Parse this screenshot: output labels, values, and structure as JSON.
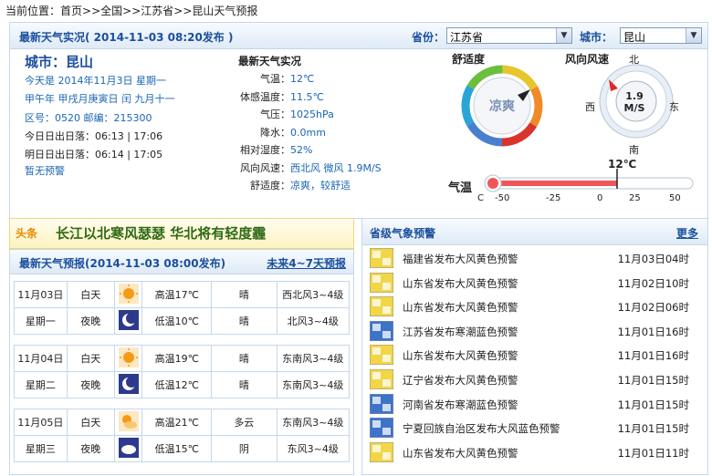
{
  "breadcrumb": {
    "prefix": "当前位置：",
    "items": [
      "首页",
      "全国",
      "江苏省",
      "昆山天气预报"
    ],
    "sep": ">>"
  },
  "top": {
    "title": "最新天气实况",
    "publish": "( 2014-11-03  08:20发布 )",
    "province_label": "省份：",
    "province_value": "江苏省",
    "city_label": "城市：",
    "city_value": "昆山"
  },
  "city": {
    "name": "城市：昆山",
    "date": "今天是 2014年11月3日 星期一",
    "lunar": "甲午年 甲戌月庚寅日 闰 九月十一",
    "codes": "区号：0520   邮编：215300",
    "sun_today": "今日日出日落：06:13 | 17:06",
    "sun_tomorrow": "明日日出日落：06:14 | 17:05",
    "alert": "暂无预警"
  },
  "live": {
    "heading": "最新天气实况",
    "rows": [
      {
        "label": "气温：",
        "value": "12℃"
      },
      {
        "label": "体感温度：",
        "value": "11.5℃"
      },
      {
        "label": "气压：",
        "value": "1025hPa"
      },
      {
        "label": "降水：",
        "value": "0.0mm"
      },
      {
        "label": "相对湿度：",
        "value": "52%"
      },
      {
        "label": "风向风速：",
        "value": "西北风 微风 1.9M/S"
      },
      {
        "label": "舒适度：",
        "value": "凉爽，较舒适"
      }
    ]
  },
  "comfort": {
    "label": "舒适度",
    "value": "凉爽"
  },
  "wind": {
    "label": "风向风速",
    "speed": "1.9",
    "unit": "M/S",
    "n": "北",
    "s": "南",
    "e": "东",
    "w": "西"
  },
  "thermo": {
    "label": "气温",
    "value_text": "12℃",
    "unit": "C",
    "ticks": [
      "-50",
      "-25",
      "0",
      "25",
      "50"
    ],
    "value": 12
  },
  "headline": {
    "tag": "头条",
    "text": "长江以北寒风瑟瑟  华北将有轻度霾"
  },
  "forecast": {
    "title": "最新天气预报",
    "publish": "(2014-11-03  08:00发布)",
    "link": "未来4~7天预报",
    "days": [
      {
        "date": "11月03日",
        "week": "星期一",
        "day": {
          "period": "白天",
          "icon": "sunny-icon",
          "temp": "高温17℃",
          "weather": "晴",
          "wind": "西北风3~4级"
        },
        "night": {
          "period": "夜晚",
          "icon": "moon-icon",
          "temp": "低温10℃",
          "weather": "晴",
          "wind": "北风3~4级"
        }
      },
      {
        "date": "11月04日",
        "week": "星期二",
        "day": {
          "period": "白天",
          "icon": "sunny-icon",
          "temp": "高温19℃",
          "weather": "晴",
          "wind": "东南风3~4级"
        },
        "night": {
          "period": "夜晚",
          "icon": "moon-icon",
          "temp": "低温12℃",
          "weather": "晴",
          "wind": "东南风3~4级"
        }
      },
      {
        "date": "11月05日",
        "week": "星期三",
        "day": {
          "period": "白天",
          "icon": "partly-cloudy-icon",
          "temp": "高温21℃",
          "weather": "多云",
          "wind": "东南风3~4级"
        },
        "night": {
          "period": "夜晚",
          "icon": "cloud-night-icon",
          "temp": "低温15℃",
          "weather": "阴",
          "wind": "东风3~4级"
        }
      }
    ]
  },
  "warnings": {
    "title": "省级气象预警",
    "more": "更多",
    "items": [
      {
        "text": "福建省发布大风黄色预警",
        "date": "11月03日04时",
        "color": "#f1d648"
      },
      {
        "text": "山东省发布大风黄色预警",
        "date": "11月02日10时",
        "color": "#f1d648"
      },
      {
        "text": "山东省发布大风黄色预警",
        "date": "11月02日06时",
        "color": "#f1d648"
      },
      {
        "text": "江苏省发布寒潮蓝色预警",
        "date": "11月01日16时",
        "color": "#3d73c9"
      },
      {
        "text": "山东省发布大风黄色预警",
        "date": "11月01日16时",
        "color": "#f1d648"
      },
      {
        "text": "辽宁省发布大风黄色预警",
        "date": "11月01日15时",
        "color": "#f1d648"
      },
      {
        "text": "河南省发布寒潮蓝色预警",
        "date": "11月01日15时",
        "color": "#3d73c9"
      },
      {
        "text": "宁夏回族自治区发布大风蓝色预警",
        "date": "11月01日15时",
        "color": "#3d73c9"
      },
      {
        "text": "山东省发布大风黄色预警",
        "date": "11月01日11时",
        "color": "#f1d648"
      }
    ]
  }
}
